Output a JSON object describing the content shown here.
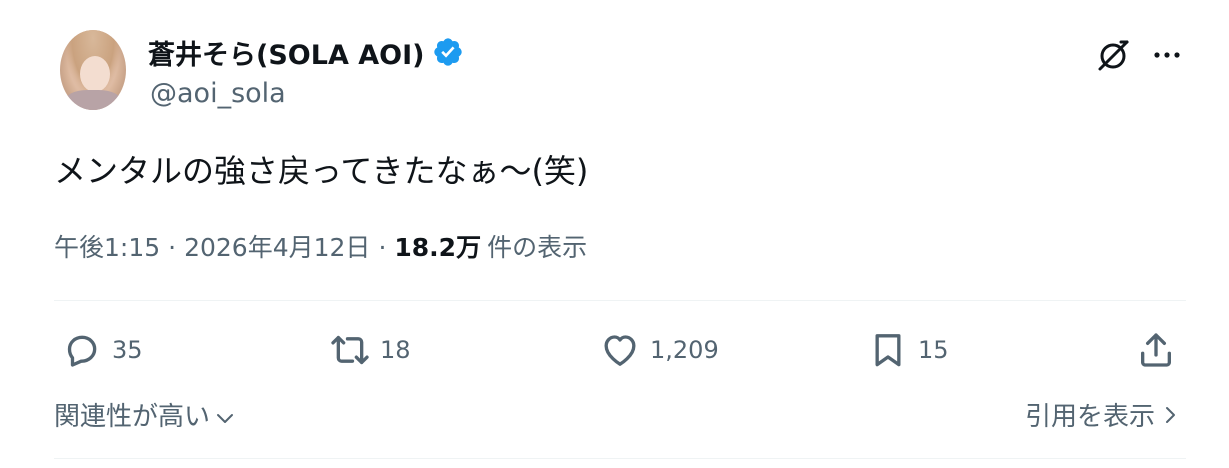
{
  "author": {
    "display_name": "蒼井そら(SOLA AOI)",
    "handle": "@aoi_sola",
    "verified_icon": "verified-badge-icon",
    "badge_color": "#1d9bf0"
  },
  "post": {
    "text": "メンタルの強さ戻ってきたなぁ～(笑)",
    "time": "午後1:15",
    "date": "2026年4月12日",
    "views_count": "18.2万",
    "views_label": "件の表示",
    "separator": "·"
  },
  "actions": {
    "reply_count": "35",
    "retweet_count": "18",
    "like_count": "1,209",
    "bookmark_count": "15"
  },
  "footer": {
    "related_label": "関連性が高い",
    "quotes_label": "引用を表示"
  },
  "colors": {
    "text_primary": "#0f1419",
    "text_secondary": "#536471",
    "divider": "#eff3f4"
  }
}
